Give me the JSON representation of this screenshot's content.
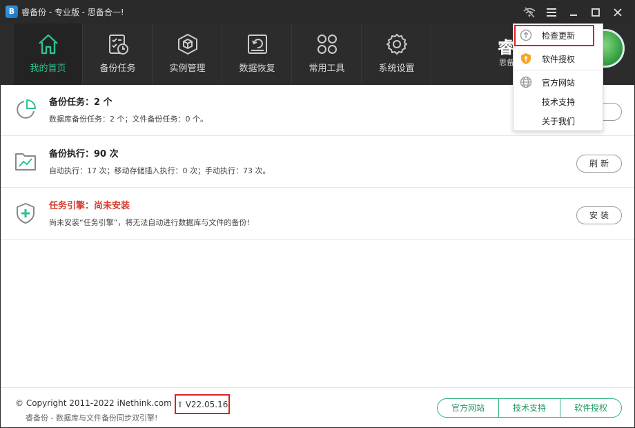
{
  "window": {
    "title": "睿备份 - 专业版 - 思备合一!",
    "logo_char": "B"
  },
  "titlebar": {
    "icons": [
      "wifi-off-icon",
      "menu-icon",
      "minimize-icon",
      "maximize-icon",
      "close-icon"
    ]
  },
  "nav": {
    "items": [
      {
        "label": "我的首页",
        "icon": "home-icon",
        "active": true
      },
      {
        "label": "备份任务",
        "icon": "backup-task-icon",
        "active": false
      },
      {
        "label": "实例管理",
        "icon": "instance-cube-icon",
        "active": false
      },
      {
        "label": "数据恢复",
        "icon": "restore-icon",
        "active": false
      },
      {
        "label": "常用工具",
        "icon": "tools-grid-icon",
        "active": false
      },
      {
        "label": "系统设置",
        "icon": "gear-icon",
        "active": false
      }
    ],
    "brand_big": "睿",
    "brand_small": "思备"
  },
  "rows": [
    {
      "title": "备份任务：2 个",
      "subtitle": "数据库备份任务：2 个；文件备份任务：0 个。",
      "button": "新",
      "icon": "pie-chart-icon",
      "warn": false
    },
    {
      "title": "备份执行：90 次",
      "subtitle": "自动执行：17 次；移动存储插入执行：0 次；手动执行：73 次。",
      "button": "刷新",
      "icon": "folder-chart-icon",
      "warn": false
    },
    {
      "title": "任务引擎：尚未安装",
      "subtitle": "尚未安装“任务引擎”，将无法自动进行数据库与文件的备份!",
      "button": "安装",
      "icon": "shield-plus-icon",
      "warn": true
    }
  ],
  "menu": {
    "items": [
      {
        "label": "检查更新",
        "icon": "upload-circle-icon"
      },
      {
        "label": "软件授权",
        "icon": "key-shield-icon"
      },
      {
        "label": "官方网站",
        "icon": "globe-icon"
      },
      {
        "label": "技术支持",
        "icon": ""
      },
      {
        "label": "关于我们",
        "icon": ""
      }
    ]
  },
  "footer": {
    "copyright": "© Copyright 2011-2022 iNethink.com",
    "tagline": "睿备份 - 数据库与文件备份同步双引擎!",
    "version_arrow": "⬆",
    "version": "V22.05.16",
    "links": [
      "官方网站",
      "技术支持",
      "软件授权"
    ]
  },
  "colors": {
    "accent": "#2fc28a",
    "warning": "#d83a2b",
    "highlight": "#e02020",
    "titlebar": "#2a2a2a",
    "navbar": "#2c2c2c"
  }
}
